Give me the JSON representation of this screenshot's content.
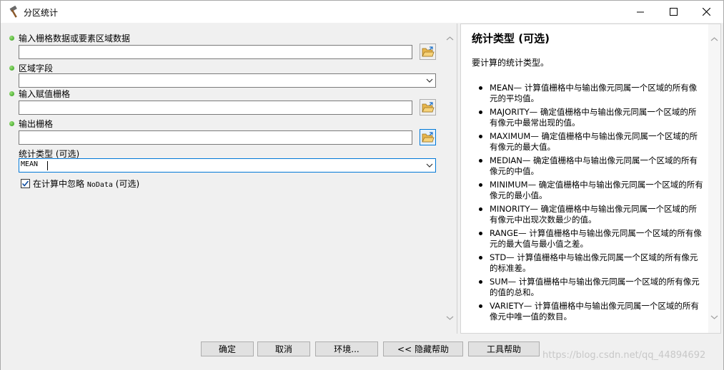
{
  "window": {
    "title": "分区统计"
  },
  "params": {
    "input_zone": {
      "label": "输入栅格数据或要素区域数据",
      "value": ""
    },
    "zone_field": {
      "label": "区域字段",
      "value": ""
    },
    "value_raster": {
      "label": "输入赋值栅格",
      "value": ""
    },
    "output_raster": {
      "label": "输出栅格",
      "value": ""
    },
    "statistics_type": {
      "label": "统计类型 (可选)",
      "value": "MEAN"
    },
    "ignore_nodata": {
      "label_pre": "在计算中忽略 ",
      "label_mono": "NoData",
      "label_post": " (可选)",
      "checked": true
    }
  },
  "help": {
    "title": "统计类型 (可选)",
    "description": "要计算的统计类型。",
    "items": [
      "MEAN— 计算值栅格中与输出像元同属一个区域的所有像元的平均值。",
      "MAJORITY— 确定值栅格中与输出像元同属一个区域的所有像元中最常出现的值。",
      "MAXIMUM— 确定值栅格中与输出像元同属一个区域的所有像元的最大值。",
      "MEDIAN— 确定值栅格中与输出像元同属一个区域的所有像元的中值。",
      "MINIMUM— 确定值栅格中与输出像元同属一个区域的所有像元的最小值。",
      "MINORITY— 确定值栅格中与输出像元同属一个区域的所有像元中出现次数最少的值。",
      "RANGE— 计算值栅格中与输出像元同属一个区域的所有像元的最大值与最小值之差。",
      "STD— 计算值栅格中与输出像元同属一个区域的所有像元的标准差。",
      "SUM— 计算值栅格中与输出像元同属一个区域的所有像元的值的总和。",
      "VARIETY— 计算值栅格中与输出像元同属一个区域的所有像元中唯一值的数目。"
    ]
  },
  "buttons": {
    "ok": "确定",
    "cancel": "取消",
    "environments": "环境...",
    "hide_help": "<< 隐藏帮助",
    "tool_help": "工具帮助"
  },
  "watermark": "https://blog.csdn.net/qq_44894692",
  "icons": {
    "app": "hammer-icon",
    "folder": "open-folder-icon",
    "dropdown": "chevron-down-icon"
  },
  "colors": {
    "focus_border": "#0078d7",
    "required_dot": "#2f9a18"
  }
}
